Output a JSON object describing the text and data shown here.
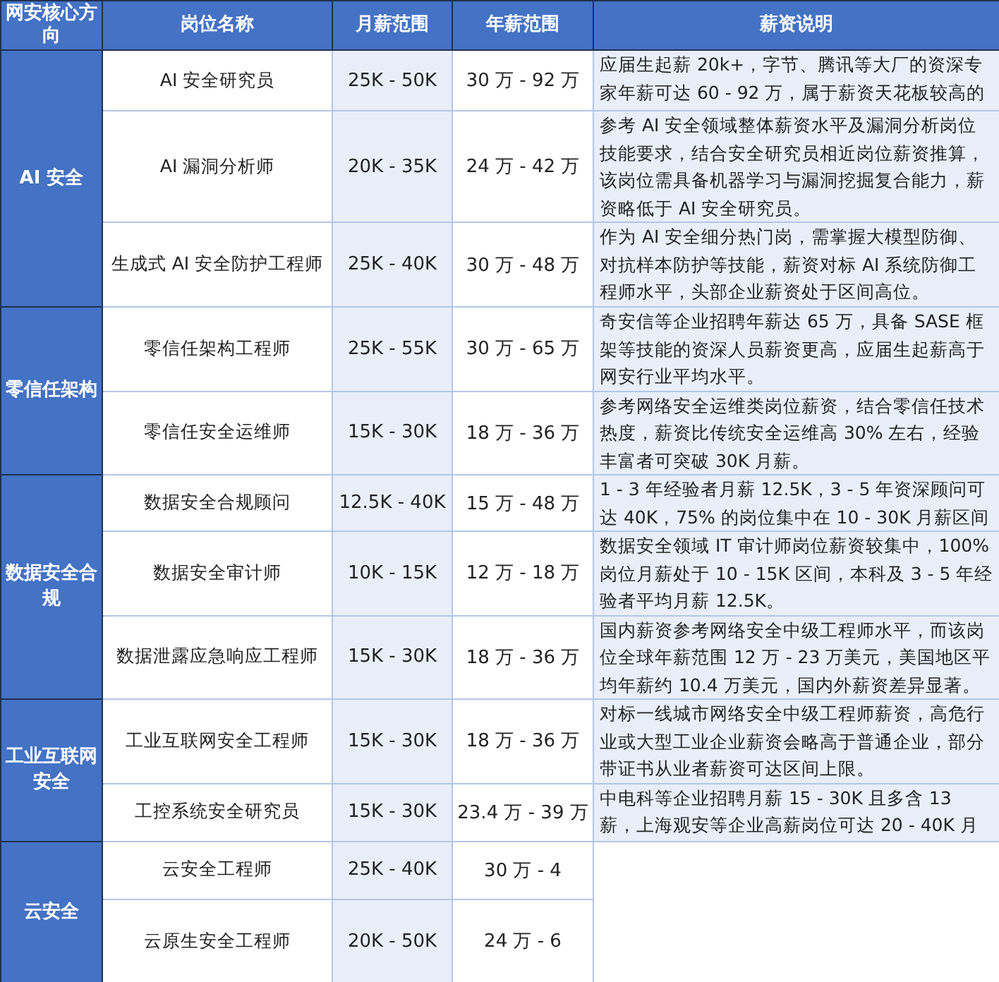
{
  "table": {
    "columns": [
      "网安核心方向",
      "岗位名称",
      "月薪范围",
      "年薪范围",
      "薪资说明"
    ],
    "groups": [
      {
        "name": "AI 安全",
        "jobs": [
          {
            "title": "AI 安全研究员",
            "monthly": "25K - 50K",
            "annual": "30 万 - 92 万",
            "note": "应届生起薪 20k+，字节、腾讯等大厂的资深专家年薪可达 60 - 92 万，属于薪资天花板较高的"
          },
          {
            "title": "AI 漏洞分析师",
            "monthly": "20K - 35K",
            "annual": "24 万 - 42 万",
            "note": "参考 AI 安全领域整体薪资水平及漏洞分析岗位技能要求，结合安全研究员相近岗位薪资推算，该岗位需具备机器学习与漏洞挖掘复合能力，薪资略低于 AI 安全研究员。"
          },
          {
            "title": "生成式 AI 安全防护工程师",
            "monthly": "25K - 40K",
            "annual": "30 万 - 48 万",
            "note": "作为 AI 安全细分热门岗，需掌握大模型防御、对抗样本防护等技能，薪资对标 AI 系统防御工程师水平，头部企业薪资处于区间高位。"
          }
        ]
      },
      {
        "name": "零信任架构",
        "jobs": [
          {
            "title": "零信任架构工程师",
            "monthly": "25K - 55K",
            "annual": "30 万 - 65 万",
            "note": "奇安信等企业招聘年薪达 65 万，具备 SASE 框架等技能的资深人员薪资更高，应届生起薪高于网安行业平均水平。"
          },
          {
            "title": "零信任安全运维师",
            "monthly": "15K - 30K",
            "annual": "18 万 - 36 万",
            "note": "参考网络安全运维类岗位薪资，结合零信任技术热度，薪资比传统安全运维高 30% 左右，经验丰富者可突破 30K 月薪。"
          }
        ]
      },
      {
        "name": "数据安全合规",
        "jobs": [
          {
            "title": "数据安全合规顾问",
            "monthly": "12.5K - 40K",
            "annual": "15 万 - 48 万",
            "note": "1 - 3 年经验者月薪 12.5K，3 - 5 年资深顾问可达 40K，75% 的岗位集中在 10 - 30K 月薪区间"
          },
          {
            "title": "数据安全审计师",
            "monthly": "10K - 15K",
            "annual": "12 万 - 18 万",
            "note": "数据安全领域 IT 审计师岗位薪资较集中，100% 岗位月薪处于 10 - 15K 区间，本科及 3 - 5 年经验者平均月薪 12.5K。"
          },
          {
            "title": "数据泄露应急响应工程师",
            "monthly": "15K - 30K",
            "annual": "18 万 - 36 万",
            "note": "国内薪资参考网络安全中级工程师水平，而该岗位全球年薪范围 12 万 - 23 万美元，美国地区平均年薪约 10.4 万美元，国内外薪资差异显著。"
          }
        ]
      },
      {
        "name": "工业互联网安全",
        "jobs": [
          {
            "title": "工业互联网安全工程师",
            "monthly": "15K - 30K",
            "annual": "18 万 - 36 万",
            "note": "对标一线城市网络安全中级工程师薪资，高危行业或大型工业企业薪资会略高于普通企业，部分带证书从业者薪资可达区间上限。"
          },
          {
            "title": "工控系统安全研究员",
            "monthly": "15K - 30K",
            "annual": "23.4 万 - 39 万",
            "note": "中电科等企业招聘月薪 15 - 30K 且多含 13 薪，上海观安等企业高薪岗位可达 20 - 40K 月"
          }
        ]
      },
      {
        "name": "云安全",
        "jobs": [
          {
            "title": "云安全工程师",
            "monthly": "25K - 40K",
            "annual": "30 万 - 4"
          },
          {
            "title": "云原生安全工程师",
            "monthly": "20K - 50K",
            "annual": "24 万 - 6"
          }
        ]
      }
    ]
  }
}
